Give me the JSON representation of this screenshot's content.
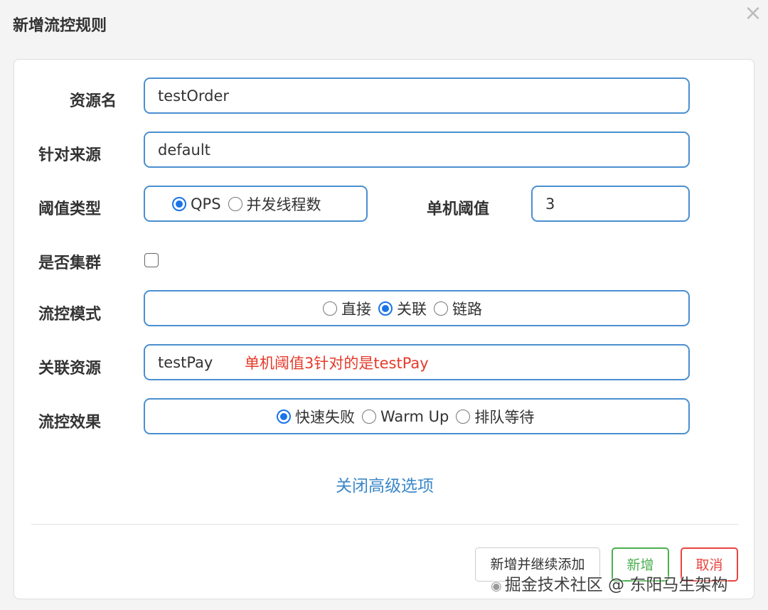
{
  "dialog": {
    "title": "新增流控规则",
    "close_icon": "×"
  },
  "form": {
    "resource": {
      "label": "资源名",
      "value": "testOrder"
    },
    "source": {
      "label": "针对来源",
      "value": "default"
    },
    "threshold_type": {
      "label": "阈值类型",
      "options": [
        "QPS",
        "并发线程数"
      ],
      "selected": "QPS"
    },
    "single_threshold": {
      "label": "单机阈值",
      "value": "3"
    },
    "cluster": {
      "label": "是否集群",
      "checked": false
    },
    "mode": {
      "label": "流控模式",
      "options": [
        "直接",
        "关联",
        "链路"
      ],
      "selected": "关联"
    },
    "related_resource": {
      "label": "关联资源",
      "value": "testPay",
      "note": "单机阈值3针对的是testPay"
    },
    "effect": {
      "label": "流控效果",
      "options": [
        "快速失败",
        "Warm Up",
        "排队等待"
      ],
      "selected": "快速失败"
    },
    "advanced_toggle": "关闭高级选项"
  },
  "buttons": {
    "add_continue": "新增并继续添加",
    "add": "新增",
    "cancel": "取消"
  },
  "watermark": "掘金技术社区 @ 东阳马生架构",
  "colors": {
    "accent": "#4a8fd0",
    "radio_selected": "#1a73e8",
    "note": "#e53a2a",
    "link": "#3a87c8",
    "add_button": "#4caf50",
    "cancel_button": "#e8433f"
  }
}
